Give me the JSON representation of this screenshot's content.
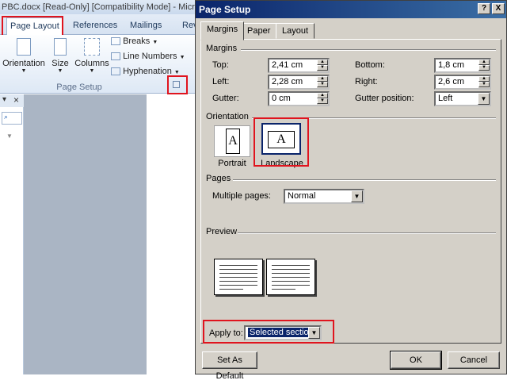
{
  "word": {
    "window_title": "PBC.docx [Read-Only] [Compatibility Mode] - Microsoft",
    "tabs": [
      "Page Layout",
      "References",
      "Mailings",
      "Rev"
    ],
    "buttons": {
      "orientation": "Orientation",
      "size": "Size",
      "columns": "Columns"
    },
    "commands": {
      "breaks": "Breaks",
      "line_numbers": "Line Numbers",
      "hyphenation": "Hyphenation"
    },
    "group_label": "Page Setup",
    "nav_close": "×"
  },
  "dialog": {
    "title": "Page Setup",
    "help": "?",
    "close": "X",
    "tabs": [
      "Margins",
      "Paper",
      "Layout"
    ],
    "margins_section": "Margins",
    "top_label": "Top:",
    "top_value": "2,41 cm",
    "bottom_label": "Bottom:",
    "bottom_value": "1,8 cm",
    "left_label": "Left:",
    "left_value": "2,28 cm",
    "right_label": "Right:",
    "right_value": "2,6 cm",
    "gutter_label": "Gutter:",
    "gutter_value": "0 cm",
    "gutter_pos_label": "Gutter position:",
    "gutter_pos_value": "Left",
    "orientation_section": "Orientation",
    "portrait": "Portrait",
    "landscape": "Landscape",
    "orientation_icon_letter": "A",
    "pages_section": "Pages",
    "multiple_pages_label": "Multiple pages:",
    "multiple_pages_value": "Normal",
    "preview_section": "Preview",
    "apply_to_label": "Apply to:",
    "apply_to_value": "Selected sections",
    "set_default": "Set As Default",
    "ok": "OK",
    "cancel": "Cancel"
  },
  "colors": {
    "highlight_box": "#e0141e",
    "dialog_bg": "#d4d0c8",
    "title_bar": "#0a246a"
  }
}
